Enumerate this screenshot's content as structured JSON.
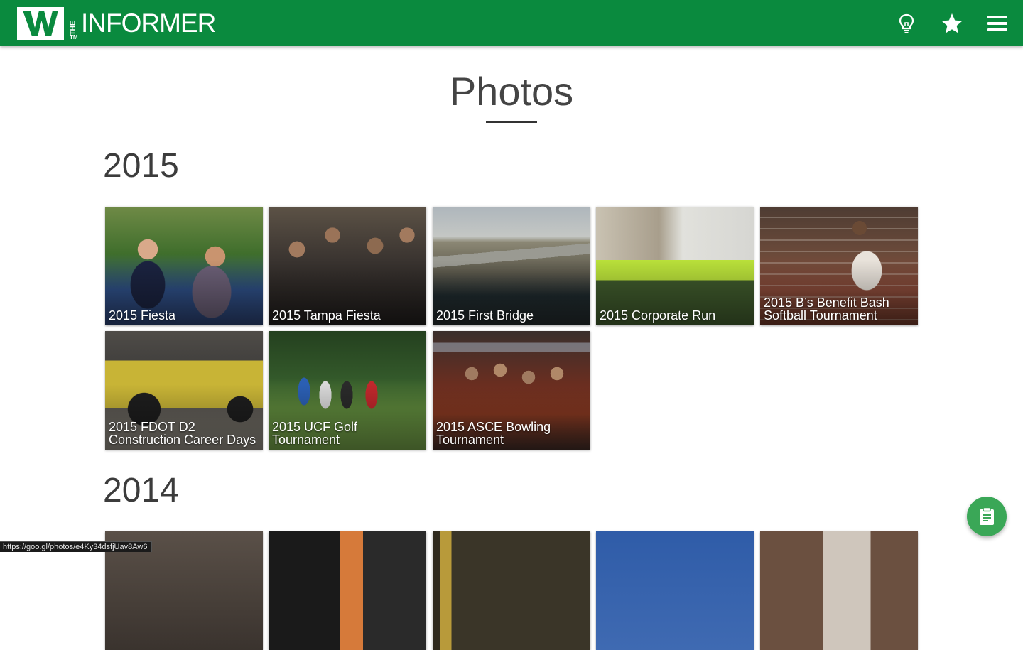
{
  "header": {
    "logo_letter": "W",
    "logo_the": "THE",
    "logo_word": "INFORMER",
    "logo_tm": "TM",
    "icons": [
      "lightbulb-icon",
      "star-icon",
      "menu-icon"
    ],
    "brand_color": "#0a8a3e"
  },
  "page": {
    "title": "Photos"
  },
  "sections": [
    {
      "year": "2015",
      "albums": [
        {
          "caption": "2015 Fiesta"
        },
        {
          "caption": "2015 Tampa Fiesta"
        },
        {
          "caption": "2015 First Bridge"
        },
        {
          "caption": "2015 Corporate Run"
        },
        {
          "caption": "2015 B’s Benefit Bash Softball Tournament"
        },
        {
          "caption": "2015 FDOT D2 Construction Career Days"
        },
        {
          "caption": "2015 UCF Golf Tournament"
        },
        {
          "caption": "2015 ASCE Bowling Tournament"
        }
      ]
    },
    {
      "year": "2014"
    }
  ],
  "status_url": "https://goo.gl/photos/e4Ky34dsfjUav8Aw6",
  "fab": {
    "icon": "clipboard-icon",
    "color": "#3aa757"
  }
}
